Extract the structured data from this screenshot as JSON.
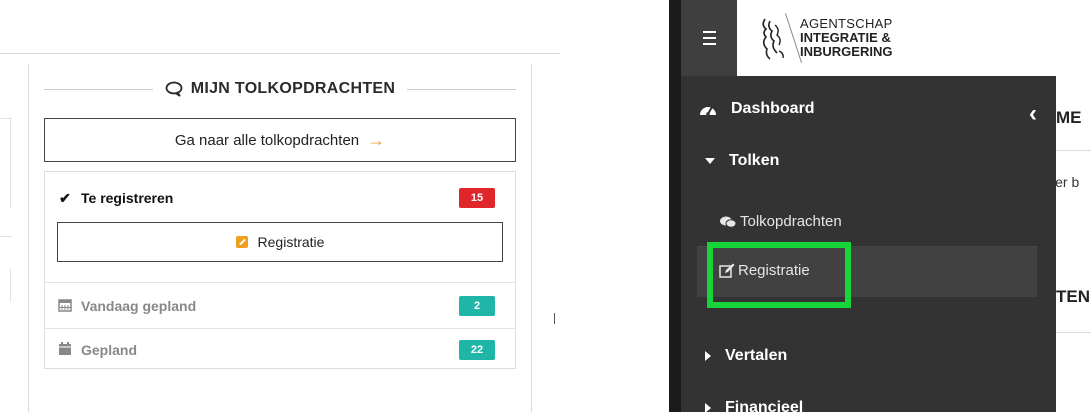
{
  "left_panel": {
    "card_title": "MIJN TOLKOPDRACHTEN",
    "go_all_label": "Ga naar alle tolkopdrachten",
    "rows": {
      "to_register": {
        "label": "Te registreren",
        "count": "15"
      },
      "registration_button": "Registratie",
      "today": {
        "label": "Vandaag gepland",
        "count": "2"
      },
      "planned": {
        "label": "Gepland",
        "count": "22"
      }
    }
  },
  "right_panel": {
    "logo": {
      "line1": "AGENTSCHAP",
      "line2": "INTEGRATIE &",
      "line3": "INBURGERING"
    },
    "sidebar": {
      "dashboard": "Dashboard",
      "tolken": "Tolken",
      "tolkopdrachten": "Tolkopdrachten",
      "registratie": "Registratie",
      "vertalen": "Vertalen",
      "financieel": "Financieel"
    },
    "content_fragments": {
      "header1": "ME",
      "text1": "ler b",
      "header2": "TEN"
    }
  },
  "colors": {
    "badge_red": "#e0252b",
    "badge_teal": "#1fb5a7",
    "accent_orange": "#f0a020",
    "sidebar_bg": "#333333",
    "highlight_green": "#16d43a"
  },
  "icons": [
    "chat-icon",
    "arrow-right-icon",
    "checkmark-icon",
    "edit-icon",
    "calendar-icon",
    "hamburger-icon",
    "lion-logo-icon",
    "dashboard-icon",
    "chevron-left-icon",
    "caret-down-icon",
    "caret-right-icon",
    "comments-icon"
  ]
}
